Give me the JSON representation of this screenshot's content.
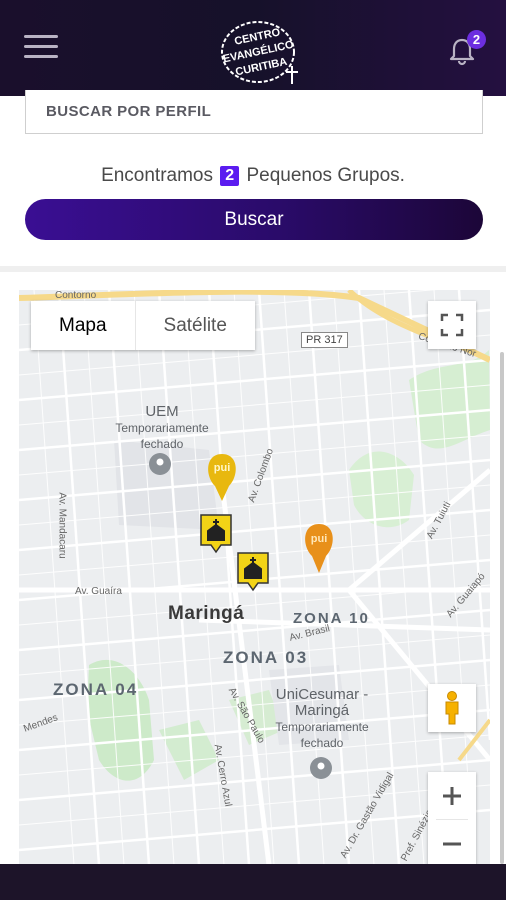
{
  "header": {
    "logo_text": "CENTRO EVANGÉLICO CURITIBA",
    "notification_count": "2"
  },
  "search": {
    "placeholder": "BUSCAR POR PERFIL"
  },
  "results": {
    "prefix": "Encontramos",
    "count": "2",
    "suffix": "Pequenos Grupos."
  },
  "buscar_button": {
    "label": "Buscar"
  },
  "map": {
    "type_options": [
      "Mapa",
      "Satélite"
    ],
    "selected_type": "Mapa",
    "city_label": "Maringá",
    "zones": [
      "ZONA 10",
      "ZONA 03",
      "ZONA 04"
    ],
    "pois": [
      {
        "name": "UEM",
        "status": "Temporariamente fechado"
      },
      {
        "name": "UniCesumar - Maringá",
        "status": "Temporariamente fechado"
      }
    ],
    "road_shield": "PR 317",
    "streets": {
      "contorno": "Contorno",
      "contorno_norte": "Contorno Nor",
      "guaira": "Av. Guaíra",
      "brasil": "Av. Brasil",
      "sao_paulo": "Av. São Paulo",
      "mandacaru": "Av. Mandacaru",
      "tuiuti": "Av. Tuiuti",
      "guaiapo": "Av. Guaiapó",
      "colombo": "Av. Colombo",
      "cerro_azul": "Av. Cerro Azul",
      "gastao": "Av. Dr. Gastão Vidigal",
      "mendes": "Mendes",
      "sinezio": "Pref. Sinézio"
    },
    "markers": {
      "pin_label": "pui",
      "church_count": 2
    },
    "colors": {
      "gold_pin": "#e8b80f",
      "orange_pin": "#e8901a",
      "church_marker": "#f2d316"
    }
  }
}
